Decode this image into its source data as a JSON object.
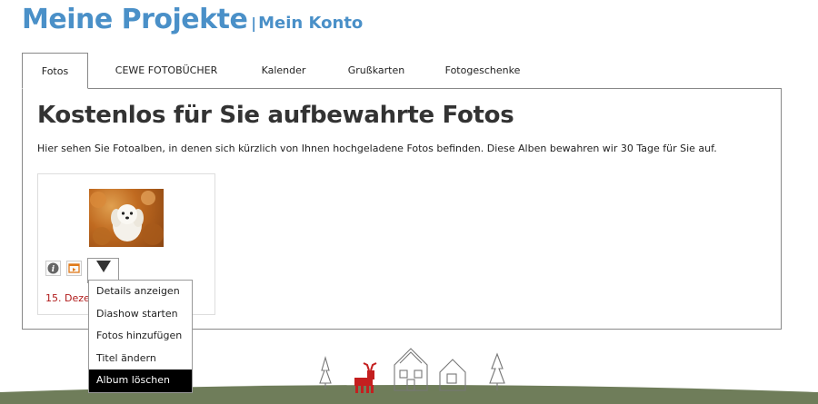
{
  "header": {
    "title": "Meine Projekte",
    "separator": "|",
    "account_link": "Mein Konto"
  },
  "tabs": [
    {
      "label": "Fotos",
      "active": true
    },
    {
      "label": "CEWE FOTOBÜCHER",
      "active": false
    },
    {
      "label": "Kalender",
      "active": false
    },
    {
      "label": "Grußkarten",
      "active": false
    },
    {
      "label": "Fotogeschenke",
      "active": false
    }
  ],
  "main": {
    "heading": "Kostenlos für Sie aufbewahrte Fotos",
    "description": "Hier sehen Sie Fotoalben, in denen sich kürzlich von Ihnen hochgeladene Fotos befinden. Diese Alben bewahren wir 30 Tage für Sie auf.",
    "album": {
      "date_visible": "15. Deze",
      "icons": [
        "info-icon",
        "slideshow-icon",
        "dropdown-arrow-icon"
      ]
    }
  },
  "menu": {
    "items": [
      {
        "label": "Details anzeigen"
      },
      {
        "label": "Diashow starten"
      },
      {
        "label": "Fotos hinzufügen"
      },
      {
        "label": "Titel ändern"
      },
      {
        "label": "Album löschen",
        "highlighted": true
      }
    ]
  },
  "colors": {
    "brand_blue": "#4a90c8",
    "date_red": "#b01a1a",
    "ground_green": "#6f7d5a",
    "reindeer_red": "#c41f1f"
  }
}
